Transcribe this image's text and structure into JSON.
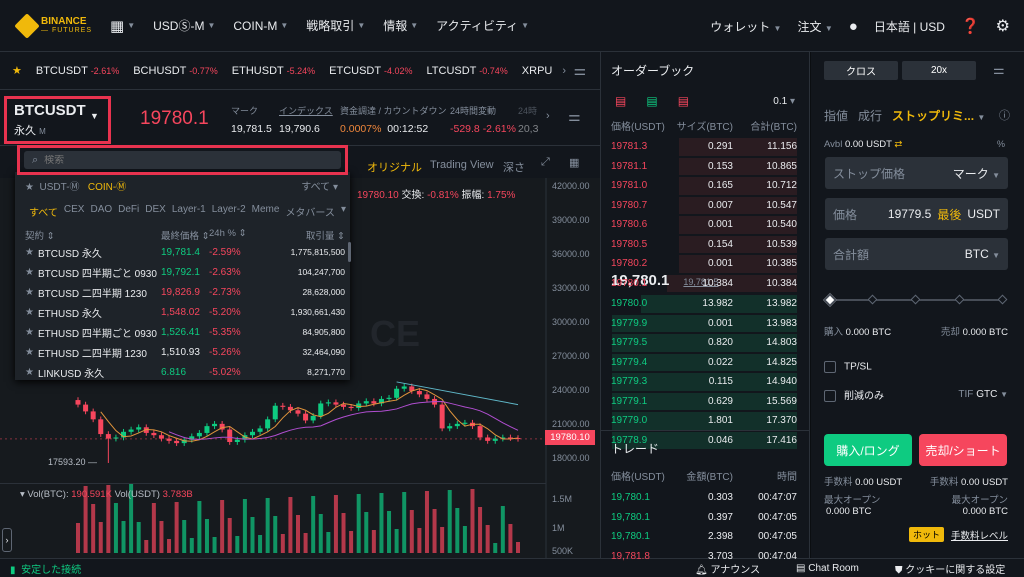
{
  "nav": {
    "logo": "BINANCE",
    "logo_sub": "— FUTURES",
    "items": [
      "USDⓈ-M",
      "COIN-M",
      "戦略取引",
      "情報",
      "アクティビティ"
    ],
    "wallet": "ウォレット",
    "orders": "注文",
    "language": "日本語",
    "currency": "USD"
  },
  "ticker": [
    {
      "sym": "BTCUSDT",
      "chg": "-2.61%"
    },
    {
      "sym": "BCHUSDT",
      "chg": "-0.77%"
    },
    {
      "sym": "ETHUSDT",
      "chg": "-5.24%"
    },
    {
      "sym": "ETCUSDT",
      "chg": "-4.02%"
    },
    {
      "sym": "LTCUSDT",
      "chg": "-0.74%"
    },
    {
      "sym": "XRPU",
      "chg": ""
    }
  ],
  "symbol": {
    "name": "BTCUSDT",
    "type": "永久",
    "badge": "M",
    "price": "19780.1",
    "stats": [
      {
        "label": "マーク",
        "value": "19,781.5"
      },
      {
        "label": "インデックス",
        "value": "19,790.6"
      },
      {
        "label": "資金調達 / カウントダウン",
        "value": "0.0007%",
        "value2": "00:12:52"
      },
      {
        "label": "24時間変動",
        "value": "-529.8 -2.61%"
      },
      {
        "label": "24時",
        "value": "20,3"
      }
    ]
  },
  "chart_toolbar": {
    "original": "オリジナル",
    "tradingview": "Trading View",
    "depth": "深さ"
  },
  "chart": {
    "info": {
      "price": "19780.10",
      "exch_label": "交換:",
      "exch": "-0.81%",
      "amp_label": "振幅:",
      "amp": "1.75%"
    },
    "yticks": [
      "42000.00",
      "39000.00",
      "36000.00",
      "33000.00",
      "30000.00",
      "27000.00",
      "24000.00",
      "21000.00",
      "18000.00"
    ],
    "current": "19780.10",
    "low_label": "17593.20",
    "watermark": "CE",
    "closes": [
      22800,
      22200,
      21500,
      20200,
      19800,
      19900,
      20400,
      20600,
      20800,
      20300,
      20100,
      19800,
      19600,
      19400,
      19700,
      20000,
      20300,
      20900,
      21100,
      20600,
      19500,
      19700,
      20100,
      20400,
      20700,
      21500,
      22700,
      22600,
      22300,
      22000,
      21400,
      21800,
      22900,
      23000,
      22800,
      22600,
      22500,
      22900,
      23100,
      22900,
      23300,
      23400,
      24200,
      24400,
      24000,
      23700,
      23300,
      22800,
      20700,
      20900,
      21100,
      21200,
      20900,
      19900,
      19600,
      19800,
      19900,
      19850,
      19780
    ],
    "vol": {
      "label_btc": "Vol(BTC):",
      "btc": "190.591K",
      "label_usdt": "Vol(USDT)",
      "usdt": "3.783B",
      "yticks": [
        "1.5M",
        "1M",
        "500K"
      ]
    }
  },
  "dropdown": {
    "search_placeholder": "検索",
    "tabs": [
      "USDT-Ⓜ",
      "COIN-Ⓜ"
    ],
    "all": "すべて",
    "categories": [
      "すべて",
      "CEX",
      "DAO",
      "DeFi",
      "DEX",
      "Layer-1",
      "Layer-2",
      "Meme",
      "メタバース"
    ],
    "headers": [
      "契約",
      "最終価格",
      "24h %",
      "取引量"
    ],
    "rows": [
      [
        "BTCUSD 永久",
        "19,781.4",
        "-2.59%",
        "1,775,815,500",
        "g"
      ],
      [
        "BTCUSD 四半期ごと 0930",
        "19,792.1",
        "-2.63%",
        "104,247,700",
        "g"
      ],
      [
        "BTCUSD 二四半期 1230",
        "19,826.9",
        "-2.73%",
        "28,628,000",
        "r"
      ],
      [
        "ETHUSD 永久",
        "1,548.02",
        "-5.20%",
        "1,930,661,430",
        "r"
      ],
      [
        "ETHUSD 四半期ごと 0930",
        "1,526.41",
        "-5.35%",
        "84,905,800",
        "g"
      ],
      [
        "ETHUSD 二四半期 1230",
        "1,510.93",
        "-5.26%",
        "32,464,090",
        "w"
      ],
      [
        "LINKUSD 永久",
        "6.816",
        "-5.02%",
        "8,271,770",
        "g"
      ]
    ]
  },
  "orderbook": {
    "title": "オーダーブック",
    "precision": "0.1",
    "headers": [
      "価格(USDT)",
      "サイズ(BTC)",
      "合計(BTC)"
    ],
    "asks": [
      [
        "19781.3",
        "0.291",
        "11.156"
      ],
      [
        "19781.1",
        "0.153",
        "10.865"
      ],
      [
        "19781.0",
        "0.165",
        "10.712"
      ],
      [
        "19780.7",
        "0.007",
        "10.547"
      ],
      [
        "19780.6",
        "0.001",
        "10.540"
      ],
      [
        "19780.5",
        "0.154",
        "10.539"
      ],
      [
        "19780.2",
        "0.001",
        "10.385"
      ],
      [
        "19780.1",
        "10.384",
        "10.384"
      ]
    ],
    "last": "19,780.1",
    "mark": "19,781.5",
    "bids": [
      [
        "19780.0",
        "13.982",
        "13.982"
      ],
      [
        "19779.9",
        "0.001",
        "13.983"
      ],
      [
        "19779.5",
        "0.820",
        "14.803"
      ],
      [
        "19779.4",
        "0.022",
        "14.825"
      ],
      [
        "19779.3",
        "0.115",
        "14.940"
      ],
      [
        "19779.1",
        "0.629",
        "15.569"
      ],
      [
        "19779.0",
        "1.801",
        "17.370"
      ],
      [
        "19778.9",
        "0.046",
        "17.416"
      ]
    ]
  },
  "trades": {
    "title": "トレード",
    "headers": [
      "価格(USDT)",
      "金額(BTC)",
      "時間"
    ],
    "rows": [
      [
        "19,780.1",
        "0.303",
        "00:47:07",
        "g"
      ],
      [
        "19,780.1",
        "0.397",
        "00:47:05",
        "g"
      ],
      [
        "19,780.1",
        "2.398",
        "00:47:05",
        "g"
      ],
      [
        "19,781.8",
        "3.703",
        "00:47:04",
        "r"
      ]
    ]
  },
  "order": {
    "margin": "クロス",
    "leverage": "20x",
    "types": [
      "指値",
      "成行",
      "ストップリミ..."
    ],
    "avbl_label": "Avbl",
    "avbl": "0.00 USDT",
    "stop_label": "ストップ価格",
    "stop_unit": "マーク",
    "price_label": "価格",
    "price": "19779.5",
    "price_last": "最後",
    "price_unit": "USDT",
    "total_label": "合計額",
    "total_unit": "BTC",
    "slider_pct": 0,
    "buy_label": "購入",
    "buy": "0.000 BTC",
    "sell_label": "売却",
    "sell": "0.000 BTC",
    "tpsl": "TP/SL",
    "reduce": "削減のみ",
    "tif_label": "TIF",
    "tif": "GTC",
    "buy_btn": "購入/ロング",
    "sell_btn": "売却/ショート",
    "fee_label": "手数料",
    "fee": "0.00 USDT",
    "max_label": "最大オープン",
    "max": "0.000 BTC",
    "hot": "ホット",
    "fee_level": "手数料レベル"
  },
  "status": {
    "connection": "安定した接続",
    "announce": "アナウンス",
    "chat": "Chat Room",
    "cookie": "クッキーに関する設定"
  },
  "colors": {
    "red": "#f6465d",
    "green": "#0ecb81",
    "yellow": "#f0b90b",
    "highlight": "#e8334f"
  }
}
